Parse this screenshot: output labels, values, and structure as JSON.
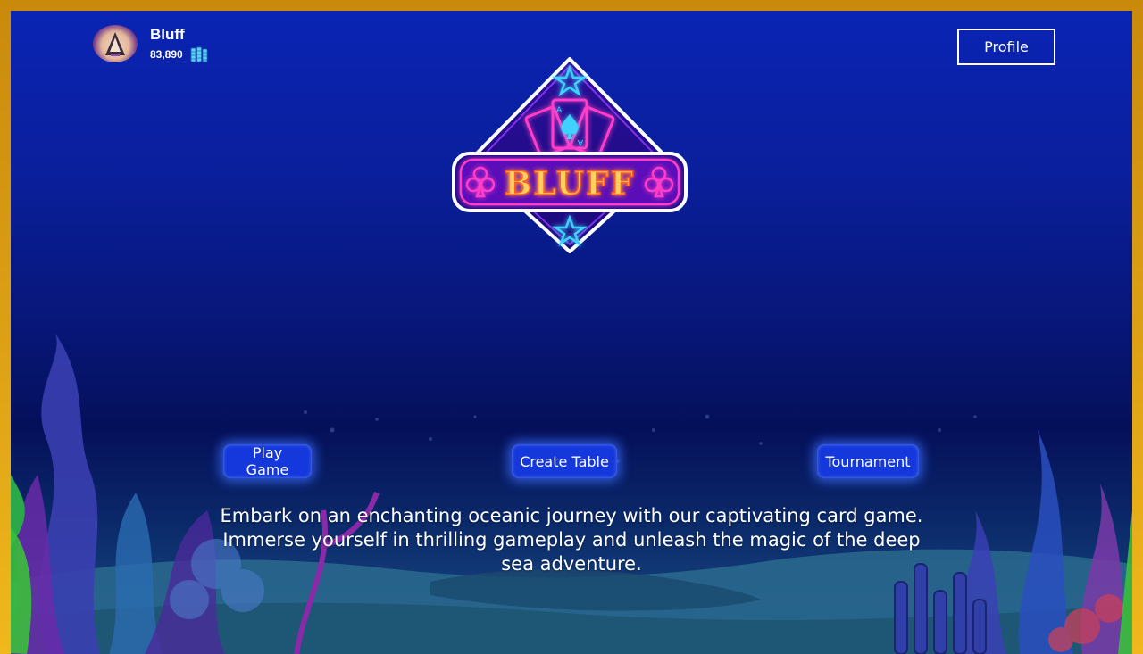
{
  "user": {
    "name": "Bluff",
    "coins": "83,890",
    "avatar_icon": "avatar-icon",
    "chip_icon": "chips-stack-icon"
  },
  "header": {
    "profile_label": "Profile"
  },
  "logo": {
    "text": "BLUFF"
  },
  "actions": {
    "play_label": "Play Game",
    "create_label": "Create Table",
    "tournament_label": "Tournament"
  },
  "tagline": "Embark on an enchanting oceanic journey with our captivating card game. Immerse yourself in thrilling gameplay and unleash the magic of the deep sea adventure.",
  "colors": {
    "frame": "#e0a416",
    "background_top": "#0a24b4",
    "background_mid": "#05105a",
    "button": "#1538dc",
    "logo_neon_pink": "#ff3ec8",
    "logo_neon_blue": "#3fd2ff",
    "logo_text": "#ffb020"
  }
}
